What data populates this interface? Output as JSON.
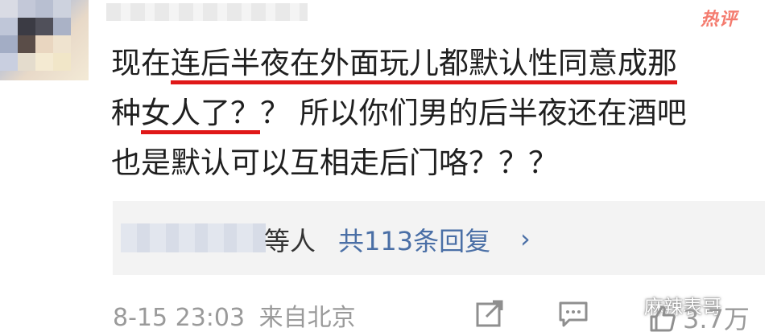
{
  "comment": {
    "hot_label": "热评",
    "lines": [
      {
        "pre": "现在",
        "ul": "连后半夜在外面玩儿都默认性同意成那",
        "post": ""
      },
      {
        "pre": "种",
        "ul": "女人了？",
        "post": "？ 所以你们男的后半夜还在酒吧"
      },
      {
        "pre": "也是默认可以互相走后门咯？？？",
        "ul": "",
        "post": ""
      }
    ],
    "underline_color": "#e01818"
  },
  "replies": {
    "suffix": "等人",
    "link": "共113条回复",
    "chevron": "›"
  },
  "meta": {
    "time": "8-15 23:03",
    "source": "来自北京"
  },
  "actions": {
    "like_count": "3.7万"
  },
  "watermark": {
    "text": "麻辣表哥"
  }
}
